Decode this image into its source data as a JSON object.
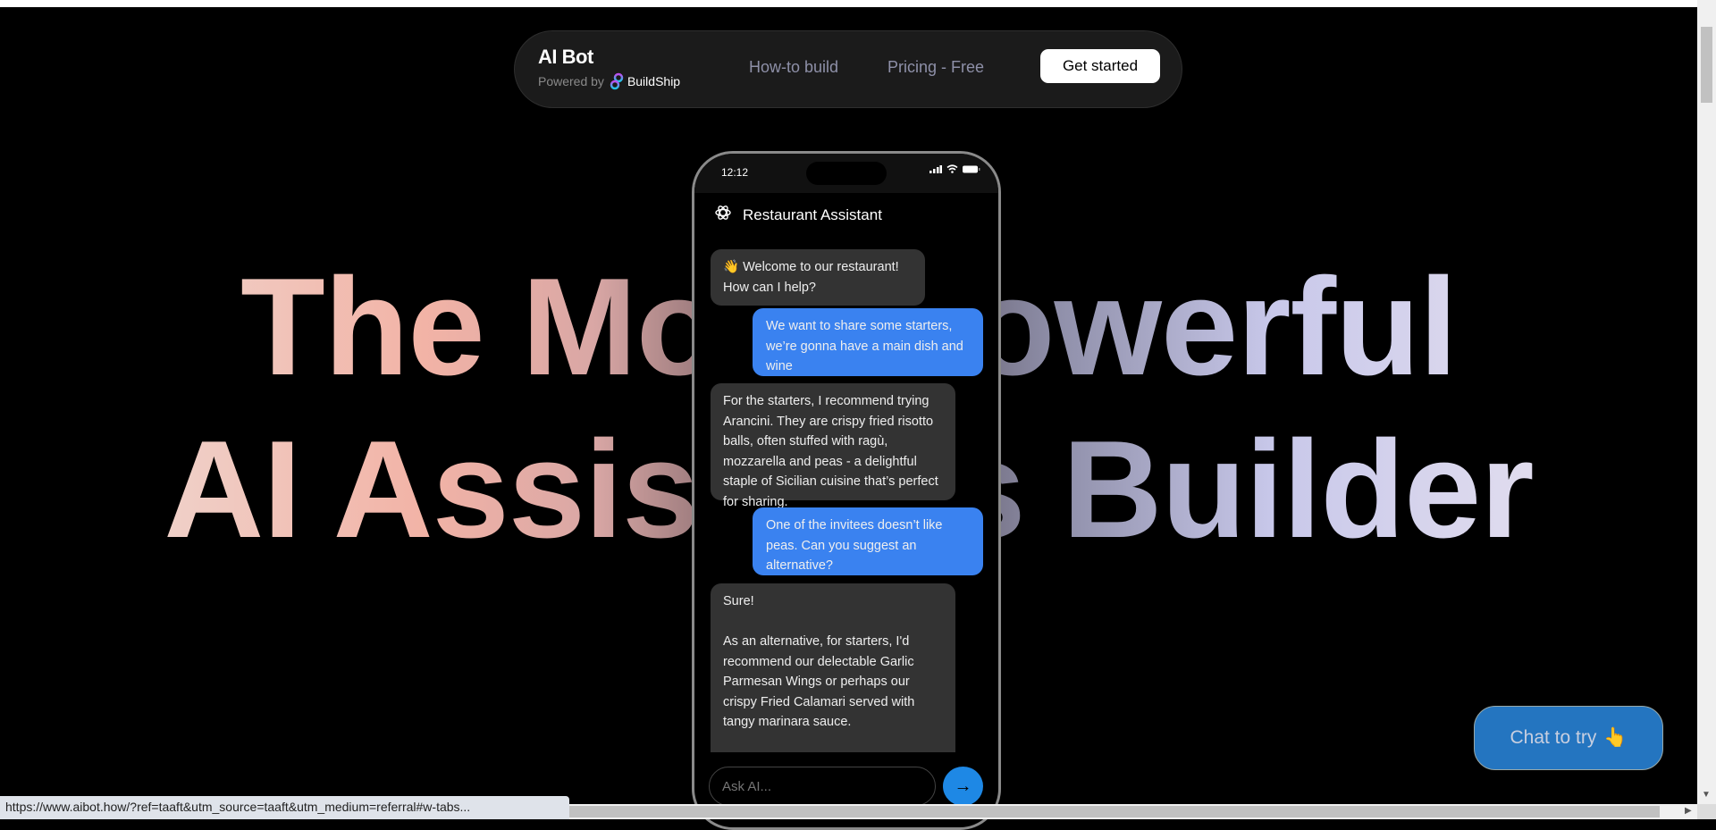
{
  "nav": {
    "brand": "AI Bot",
    "powered_by": "Powered by",
    "partner": "BuildShip",
    "links": [
      "How-to build",
      "Pricing - Free"
    ],
    "cta": "Get started"
  },
  "hero": {
    "line1": "The Most Powerful",
    "line2": "AI Assistants Builder"
  },
  "phone": {
    "time": "12:12",
    "title": "Restaurant Assistant",
    "messages": [
      {
        "role": "bot",
        "text": "👋 Welcome to our restaurant!\nHow can I help?"
      },
      {
        "role": "user",
        "text": "We want to share some starters, we’re gonna have a main dish and wine"
      },
      {
        "role": "bot",
        "text": "For the starters, I recommend trying Arancini. They are crispy fried risotto balls, often stuffed with ragù, mozzarella and peas - a delightful staple of Sicilian cuisine that’s perfect for sharing."
      },
      {
        "role": "user",
        "text": "One of the invitees doesn’t like peas. Can you suggest an alternative?"
      },
      {
        "role": "bot",
        "text": "Sure!\n\nAs an alternative, for starters, I'd recommend our delectable Garlic Parmesan Wings or perhaps our crispy Fried Calamari served with tangy marinara sauce.\n\nAs for the main course, you can't go wrong with our succulent Grilled"
      }
    ],
    "input_placeholder": "Ask AI...",
    "send_icon": "arrow-right-icon"
  },
  "chat_to_try": {
    "label": "Chat to try",
    "emoji": "👆"
  },
  "status_url": "https://www.aibot.how/?ref=taaft&utm_source=taaft&utm_medium=referral#w-tabs...",
  "colors": {
    "accent": "#3a82f0",
    "chat_button": "#2475c0",
    "send": "#1e88e5"
  }
}
